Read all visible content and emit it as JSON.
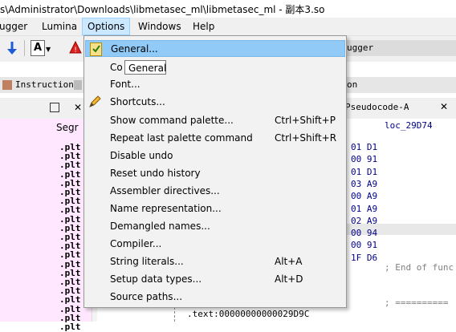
{
  "window": {
    "title": "s\\Administrator\\Downloads\\libmetasec_ml\\libmetasec_ml - 副本3.so"
  },
  "menubar": [
    {
      "label": "ugger"
    },
    {
      "label": "Lumina"
    },
    {
      "label": "Options"
    },
    {
      "label": "Windows"
    },
    {
      "label": "Help"
    }
  ],
  "tabs": {
    "debugger_tab": "ugger",
    "instruction_legend": "Instruction",
    "tab_fragment": "on",
    "pseudocode_tab": "Pseudocode-A"
  },
  "segments": {
    "header": "Segr",
    "rows": [
      ".plt",
      ".plt",
      ".plt",
      ".plt",
      ".plt",
      ".plt",
      ".plt",
      ".plt",
      ".plt",
      ".plt",
      ".plt",
      ".plt",
      ".plt",
      ".plt",
      ".plt",
      ".plt",
      ".plt",
      ".plt",
      ".plt",
      ".plt",
      ".plt"
    ]
  },
  "code": {
    "label_top": "loc_29D74",
    "hex_lines": [
      "01 D1",
      "00 91",
      "01 D1",
      "03 A9",
      "00 A9",
      "01 A9",
      "02 A9",
      "00 94",
      "00 91",
      "1F D6"
    ],
    "comment_end": "; End of func",
    "comment_sep": "; ==========",
    "address_line": ".text:00000000000029D9C"
  },
  "options_menu": {
    "items": [
      {
        "label": "General...",
        "shortcut": ""
      },
      {
        "label": "Co",
        "shortcut": ""
      },
      {
        "label": "Font...",
        "shortcut": ""
      },
      {
        "label": "Shortcuts...",
        "shortcut": ""
      },
      {
        "label": "Show command palette...",
        "shortcut": "Ctrl+Shift+P"
      },
      {
        "label": "Repeat last palette command",
        "shortcut": "Ctrl+Shift+R"
      },
      {
        "label": "Disable undo",
        "shortcut": ""
      },
      {
        "label": "Reset undo history",
        "shortcut": ""
      },
      {
        "label": "Assembler directives...",
        "shortcut": ""
      },
      {
        "label": "Name representation...",
        "shortcut": ""
      },
      {
        "label": "Demangled names...",
        "shortcut": ""
      },
      {
        "label": "Compiler...",
        "shortcut": ""
      },
      {
        "label": "String literals...",
        "shortcut": "Alt+A"
      },
      {
        "label": "Setup data types...",
        "shortcut": "Alt+D"
      },
      {
        "label": "Source paths...",
        "shortcut": ""
      }
    ]
  },
  "tooltip": {
    "text": "General"
  },
  "colors": {
    "menu_highlight": "#91c9f7",
    "menubar_open": "#cce8ff",
    "segment_bg": "#ffe8ff",
    "hex_text": "#00008b",
    "instruction_swatch": "#c08060"
  }
}
